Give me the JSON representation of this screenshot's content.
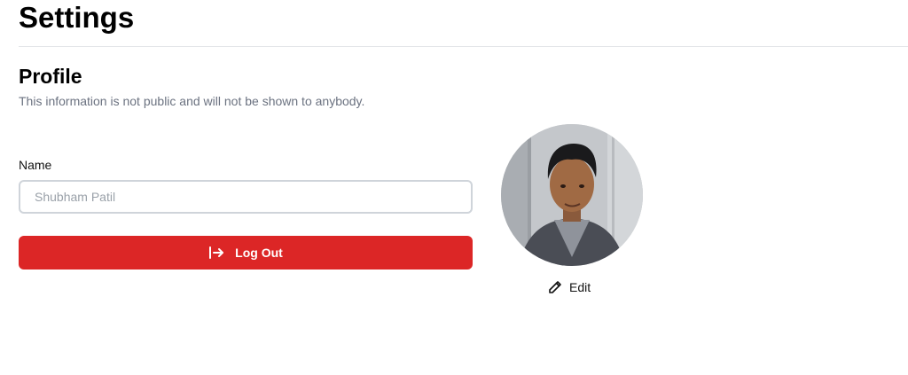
{
  "page": {
    "title": "Settings"
  },
  "profile": {
    "title": "Profile",
    "subtitle": "This information is not public and will not be shown to anybody.",
    "name_label": "Name",
    "name_placeholder": "Shubham Patil",
    "name_value": "",
    "logout_label": "Log Out",
    "logout_icon": "logout-arrow-icon",
    "edit_label": "Edit",
    "edit_icon": "pencil-icon"
  },
  "colors": {
    "danger": "#dc2626",
    "muted_text": "#6b7280",
    "divider": "#e3e5e8",
    "input_border": "#cfd4da"
  }
}
